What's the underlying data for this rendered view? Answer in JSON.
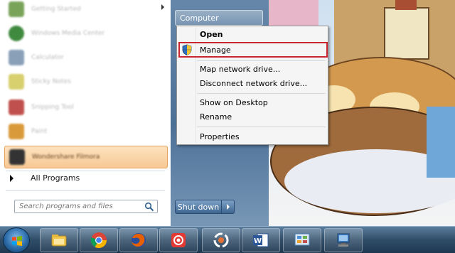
{
  "start_menu": {
    "programs": [
      {
        "label": "Getting Started",
        "icon": "getting-started-icon",
        "color": "#7aa35a",
        "has_submenu": true
      },
      {
        "label": "Windows Media Center",
        "icon": "media-center-icon",
        "color": "#3f8a3f"
      },
      {
        "label": "Calculator",
        "icon": "calculator-icon",
        "color": "#8aa0b8"
      },
      {
        "label": "Sticky Notes",
        "icon": "sticky-notes-icon",
        "color": "#d8cf6e"
      },
      {
        "label": "Snipping Tool",
        "icon": "snipping-tool-icon",
        "color": "#c0504d"
      },
      {
        "label": "Paint",
        "icon": "paint-icon",
        "color": "#d99a3c"
      },
      {
        "label": "Wondershare Filmora",
        "icon": "filmora-icon",
        "color": "#333333",
        "selected": true
      }
    ],
    "all_programs_label": "All Programs",
    "search_placeholder": "Search programs and files",
    "right_pane": {
      "computer_label": "Computer",
      "shutdown_label": "Shut down"
    }
  },
  "context_menu": {
    "items": [
      {
        "label": "Open",
        "bold": true
      },
      {
        "label": "Manage",
        "highlighted": true,
        "icon": "uac-shield-icon"
      },
      {
        "label": "Map network drive..."
      },
      {
        "label": "Disconnect network drive..."
      },
      {
        "label": "Show on Desktop"
      },
      {
        "label": "Rename"
      },
      {
        "label": "Properties"
      }
    ],
    "highlight_color": "#c9272f"
  },
  "taskbar": {
    "buttons": [
      {
        "icon": "file-explorer-icon"
      },
      {
        "icon": "chrome-icon"
      },
      {
        "icon": "firefox-icon"
      },
      {
        "icon": "record-app-icon"
      },
      {
        "icon": "sync-app-icon"
      },
      {
        "icon": "word-icon"
      },
      {
        "icon": "control-panel-icon"
      },
      {
        "icon": "network-computer-icon"
      }
    ]
  }
}
